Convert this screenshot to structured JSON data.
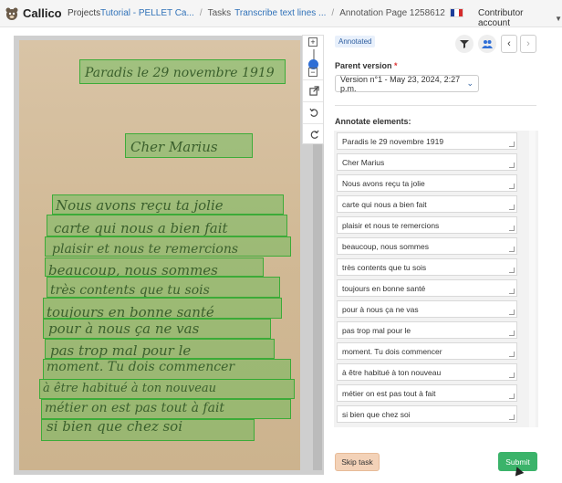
{
  "nav": {
    "brand": "Callico",
    "projects": "Projects",
    "breadcrumbs": [
      {
        "label": "Tutorial - PELLET Ca...",
        "link": true
      },
      {
        "label": "Tasks",
        "link": false
      },
      {
        "label": "Transcribe text lines ...",
        "link": true
      },
      {
        "label": "Annotation Page 1258612",
        "link": false
      }
    ],
    "account": "Contributor account",
    "flag_colors": [
      "#1f3f9a",
      "#ffffff",
      "#d52b2b"
    ]
  },
  "toolbar": {
    "zoom_in": "+",
    "zoom_out": "−",
    "tools": [
      "zoom-in-icon",
      "zoom-out-icon",
      "external-link-icon",
      "undo-icon",
      "redo-icon"
    ]
  },
  "document": {
    "lines": [
      "Paradis le 29 novembre 1919",
      "Cher Marius",
      "Nous avons reçu ta jolie",
      "carte qui nous a bien fait",
      "plaisir et nous te remercions",
      "beaucoup, nous sommes",
      "très contents que tu sois",
      "toujours en bonne santé",
      "pour à nous ça ne vas",
      "pas trop mal pour le",
      "moment. Tu dois commencer",
      "à être habitué à ton nouveau",
      "métier on est pas tout à fait",
      "si bien que chez soi"
    ],
    "highlight_color": "#3cbe3c"
  },
  "panel": {
    "badge": "Annotated",
    "parent_version_label": "Parent version",
    "required_mark": "*",
    "parent_version_value": "Version n°1 - May 23, 2024, 2:27 p.m.",
    "annotate_label": "Annotate elements:",
    "elements": [
      "Paradis le 29 novembre 1919",
      "Cher Marius",
      "Nous avons reçu ta jolie",
      "carte qui nous a bien fait",
      "plaisir et nous te remercions",
      "beaucoup, nous sommes",
      "très contents que tu sois",
      "toujours en bonne santé",
      "pour à nous ça ne vas",
      "pas trop mal pour le",
      "moment. Tu dois commencer",
      "à être habitué à ton nouveau",
      "métier on est pas tout à fait",
      "si bien que chez soi"
    ],
    "skip": "Skip task",
    "submit": "Submit"
  },
  "colors": {
    "accent": "#3273b9",
    "submit": "#3bb36a",
    "skip": "#f3d2b8"
  }
}
